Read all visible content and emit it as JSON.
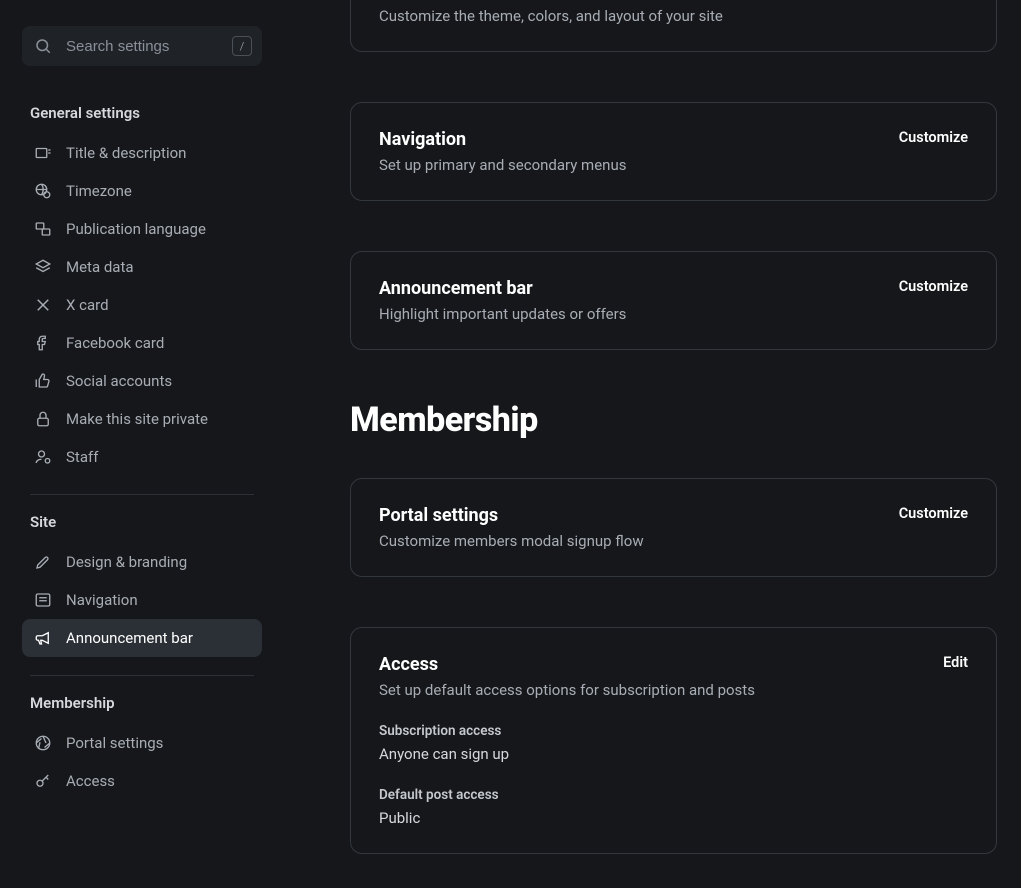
{
  "search": {
    "placeholder": "Search settings",
    "shortcut": "/"
  },
  "sidebar": {
    "groups": [
      {
        "title": "General settings",
        "items": [
          {
            "label": "Title & description"
          },
          {
            "label": "Timezone"
          },
          {
            "label": "Publication language"
          },
          {
            "label": "Meta data"
          },
          {
            "label": "X card"
          },
          {
            "label": "Facebook card"
          },
          {
            "label": "Social accounts"
          },
          {
            "label": "Make this site private"
          },
          {
            "label": "Staff"
          }
        ]
      },
      {
        "title": "Site",
        "items": [
          {
            "label": "Design & branding"
          },
          {
            "label": "Navigation"
          },
          {
            "label": "Announcement bar"
          }
        ]
      },
      {
        "title": "Membership",
        "items": [
          {
            "label": "Portal settings"
          },
          {
            "label": "Access"
          }
        ]
      }
    ]
  },
  "cards": {
    "top": {
      "desc": "Customize the theme, colors, and layout of your site"
    },
    "navigation": {
      "title": "Navigation",
      "desc": "Set up primary and secondary menus",
      "btn": "Customize"
    },
    "announcement": {
      "title": "Announcement bar",
      "desc": "Highlight important updates or offers",
      "btn": "Customize"
    },
    "portal": {
      "title": "Portal settings",
      "desc": "Customize members modal signup flow",
      "btn": "Customize"
    },
    "access": {
      "title": "Access",
      "desc": "Set up default access options for subscription and posts",
      "btn": "Edit",
      "sub_label": "Subscription access",
      "sub_value": "Anyone can sign up",
      "post_label": "Default post access",
      "post_value": "Public"
    }
  },
  "headings": {
    "membership": "Membership"
  }
}
